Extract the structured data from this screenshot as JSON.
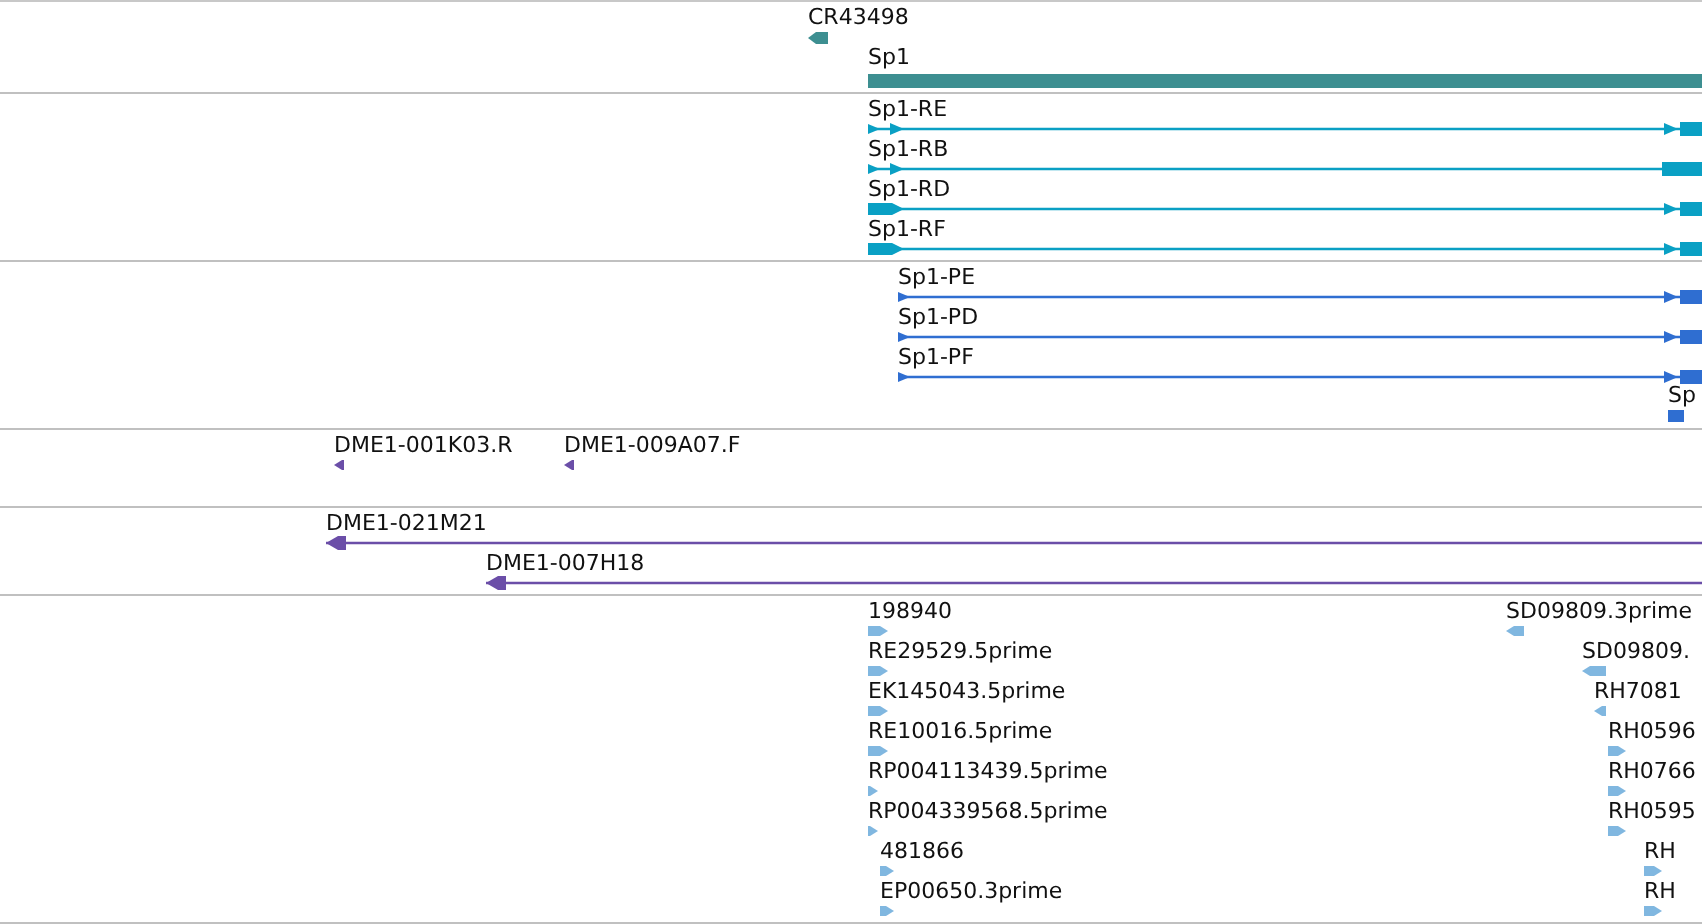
{
  "tracks": [
    {
      "features": [
        {
          "label": "CR43498",
          "reverse": true
        },
        {
          "label": "Sp1"
        }
      ]
    },
    {
      "features": [
        {
          "label": "Sp1-RE",
          "reverse": false
        },
        {
          "label": "Sp1-RB",
          "reverse": false
        },
        {
          "label": "Sp1-RD",
          "reverse": false
        },
        {
          "label": "Sp1-RF",
          "reverse": false
        }
      ]
    },
    {
      "features": [
        {
          "label": "Sp1-PE",
          "reverse": false
        },
        {
          "label": "Sp1-PD",
          "reverse": false
        },
        {
          "label": "Sp1-PF",
          "reverse": false
        },
        {
          "label": "Sp"
        }
      ]
    },
    {
      "features": [
        {
          "label": "DME1-001K03.R",
          "reverse": true
        },
        {
          "label": "DME1-009A07.F",
          "reverse": true
        }
      ]
    },
    {
      "features": [
        {
          "label": "DME1-021M21",
          "reverse": true
        },
        {
          "label": "DME1-007H18",
          "reverse": true
        }
      ]
    },
    {
      "features": [
        {
          "label": "198940",
          "reverse": false
        },
        {
          "label": "RE29529.5prime",
          "reverse": false
        },
        {
          "label": "EK145043.5prime",
          "reverse": false
        },
        {
          "label": "RE10016.5prime",
          "reverse": false
        },
        {
          "label": "RP004113439.5prime",
          "reverse": false
        },
        {
          "label": "RP004339568.5prime",
          "reverse": false
        },
        {
          "label": "481866",
          "reverse": false
        },
        {
          "label": "EP00650.3prime",
          "reverse": false
        },
        {
          "label": "SD09809.3prime",
          "reverse": true
        },
        {
          "label": "SD09809.",
          "reverse": true
        },
        {
          "label": "RH7081",
          "reverse": true
        },
        {
          "label": "RH0596",
          "reverse": false
        },
        {
          "label": "RH0766",
          "reverse": false
        },
        {
          "label": "RH0595",
          "reverse": false
        },
        {
          "label": "RH",
          "reverse": false
        },
        {
          "label": "RH",
          "reverse": false
        }
      ]
    }
  ]
}
